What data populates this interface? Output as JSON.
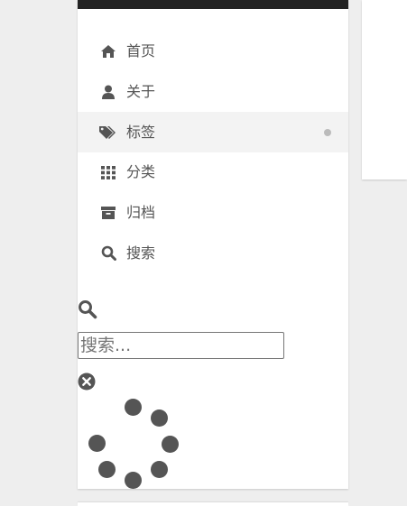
{
  "menu": {
    "items": [
      {
        "label": "首页",
        "icon": "home-icon",
        "active": false
      },
      {
        "label": "关于",
        "icon": "user-icon",
        "active": false
      },
      {
        "label": "标签",
        "icon": "tags-icon",
        "active": true
      },
      {
        "label": "分类",
        "icon": "grid-icon",
        "active": false
      },
      {
        "label": "归档",
        "icon": "archive-icon",
        "active": false
      },
      {
        "label": "搜索",
        "icon": "search-icon",
        "active": false
      }
    ]
  },
  "search": {
    "icon": "search-icon",
    "placeholder": "搜索...",
    "value": "",
    "clear_icon": "close-circle-icon"
  },
  "spinner": {
    "icon": "loading-spinner-icon"
  },
  "colors": {
    "background": "#eeeeee",
    "panel": "#ffffff",
    "topbar": "#222222",
    "text": "#555555",
    "active_row": "#f3f3f3",
    "active_dot": "#bbbbbb"
  }
}
